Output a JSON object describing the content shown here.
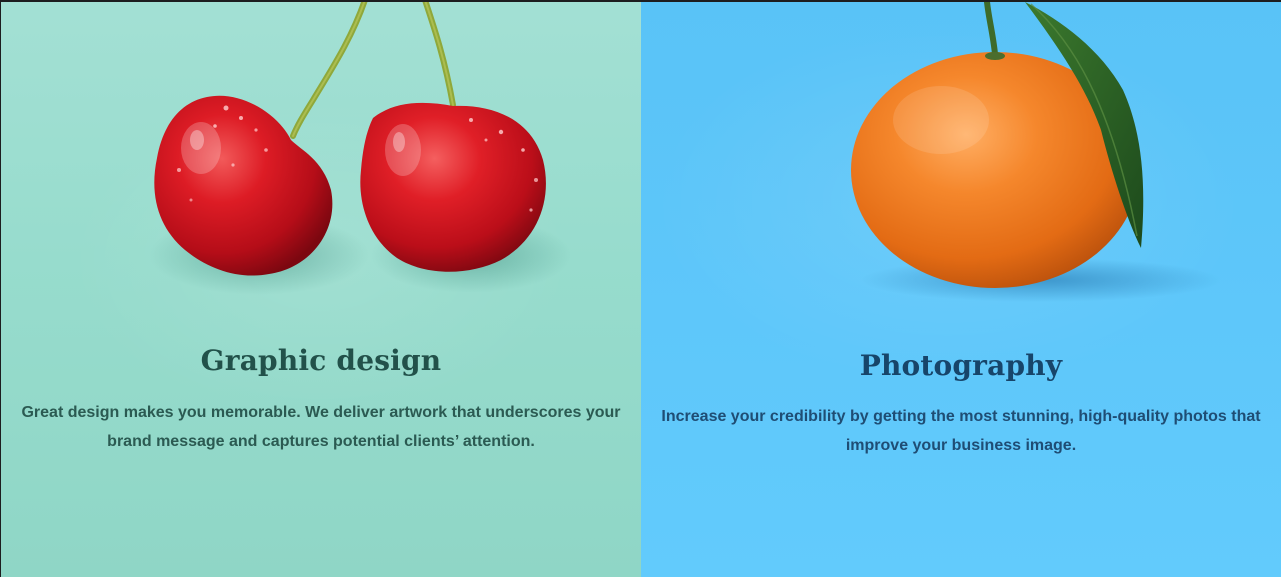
{
  "services": [
    {
      "title": "Graphic design",
      "description": "Great design makes you memorable. We deliver artwork that underscores your brand message and captures potential clients’ attention.",
      "image": "cherries",
      "background": "#97dccd",
      "title_color": "#22514a"
    },
    {
      "title": "Photography",
      "description": "Increase your credibility by getting the most stunning, high-quality photos that improve your business image.",
      "image": "orange",
      "background": "#5ec7fa",
      "title_color": "#17456a"
    }
  ]
}
